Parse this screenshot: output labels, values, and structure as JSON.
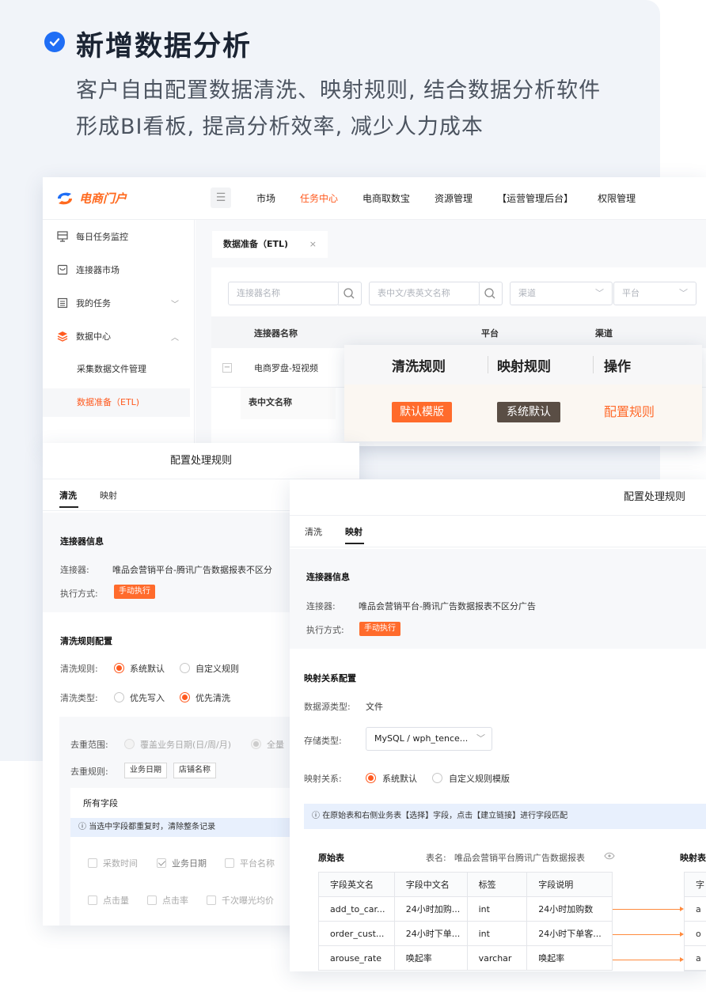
{
  "hero": {
    "title": "新增数据分析",
    "subtitle_line1": "客户自由配置数据清洗、映射规则, 结合数据分析软件",
    "subtitle_line2": "形成BI看板, 提高分析效率, 减少人力成本"
  },
  "app": {
    "logo_text": "电商门户",
    "nav": [
      "市场",
      "任务中心",
      "电商取数宝",
      "资源管理",
      "【运营管理后台】",
      "权限管理"
    ],
    "nav_active": "任务中心",
    "sidebar": {
      "items": [
        {
          "label": "每日任务监控"
        },
        {
          "label": "连接器市场"
        },
        {
          "label": "我的任务"
        },
        {
          "label": "数据中心"
        }
      ],
      "subitems": [
        {
          "label": "采集数据文件管理"
        },
        {
          "label": "数据准备（ETL)"
        }
      ]
    },
    "tab_label": "数据准备（ETL)",
    "tab_close": "×",
    "filters": {
      "connector_placeholder": "连接器名称",
      "table_placeholder": "表中文/表英文名称",
      "channel_placeholder": "渠道",
      "platform_placeholder": "平台"
    },
    "table_headers": [
      "连接器名称",
      "平台",
      "渠道"
    ],
    "row1_name": "电商罗盘-短视频",
    "row2_header": "表中文名称",
    "colors": {
      "accent": "#ff5a1f",
      "brand_blue": "#1f6ef5"
    }
  },
  "zoom": {
    "headers": [
      "清洗规则",
      "映射规则",
      "操作"
    ],
    "clean_rule": "默认模版",
    "map_rule": "系统默认",
    "action": "配置规则"
  },
  "cfg_left": {
    "title": "配置处理规则",
    "tabs": [
      "清洗",
      "映射"
    ],
    "active_tab": "清洗",
    "connector_info_title": "连接器信息",
    "connector_label": "连接器:",
    "connector_value": "唯品会营销平台-腾讯广告数据报表不区分",
    "exec_label": "执行方式:",
    "exec_value": "手动执行",
    "rule_config_title": "清洗规则配置",
    "clean_rule_label": "清洗规则:",
    "clean_rule_options": [
      "系统默认",
      "自定义规则"
    ],
    "clean_type_label": "清洗类型:",
    "clean_type_options": [
      "优先写入",
      "优先清洗"
    ],
    "dedup_scope_label": "去重范围:",
    "dedup_scope_options": [
      "覆盖业务日期(日/周/月)",
      "全量"
    ],
    "dedup_rule_label": "去重规则:",
    "dedup_rule_chips": [
      "业务日期",
      "店铺名称"
    ],
    "all_fields_title": "所有字段",
    "info_text": "当选中字段都重复时，清除整条记录",
    "fields_row1": [
      "采数时间",
      "业务日期",
      "平台名称"
    ],
    "fields_row2": [
      "点击量",
      "点击率",
      "千次曝光均价"
    ]
  },
  "cfg_right": {
    "title": "配置处理规则",
    "tabs": [
      "清洗",
      "映射"
    ],
    "active_tab": "映射",
    "connector_info_title": "连接器信息",
    "connector_label": "连接器:",
    "connector_value": "唯品会营销平台-腾讯广告数据报表不区分广告",
    "exec_label": "执行方式:",
    "exec_value": "手动执行",
    "map_config_title": "映射关系配置",
    "source_type_label": "数据源类型:",
    "source_type_value": "文件",
    "storage_label": "存储类型:",
    "storage_value": "MySQL / wph_tence...",
    "map_label": "映射关系:",
    "map_options": [
      "系统默认",
      "自定义规则模版"
    ],
    "info_text": "在原始表和右侧业务表【选择】字段，点击【建立链接】进行字段匹配",
    "orig_table_title": "原始表",
    "table_name_label": "表名:",
    "table_name_value": "唯品会营销平台腾讯广告数据报表",
    "map_table_title": "映射表",
    "columns": [
      "字段英文名",
      "字段中文名",
      "标签",
      "字段说明"
    ],
    "rows": [
      [
        "add_to_car...",
        "24小时加购...",
        "int",
        "24小时加购数"
      ],
      [
        "order_cust...",
        "24小时下单...",
        "int",
        "24小时下单客..."
      ],
      [
        "arouse_rate",
        "唤起率",
        "varchar",
        "唤起率"
      ]
    ],
    "right_col_header": "字",
    "right_col_values": [
      "a",
      "o",
      "a"
    ]
  }
}
